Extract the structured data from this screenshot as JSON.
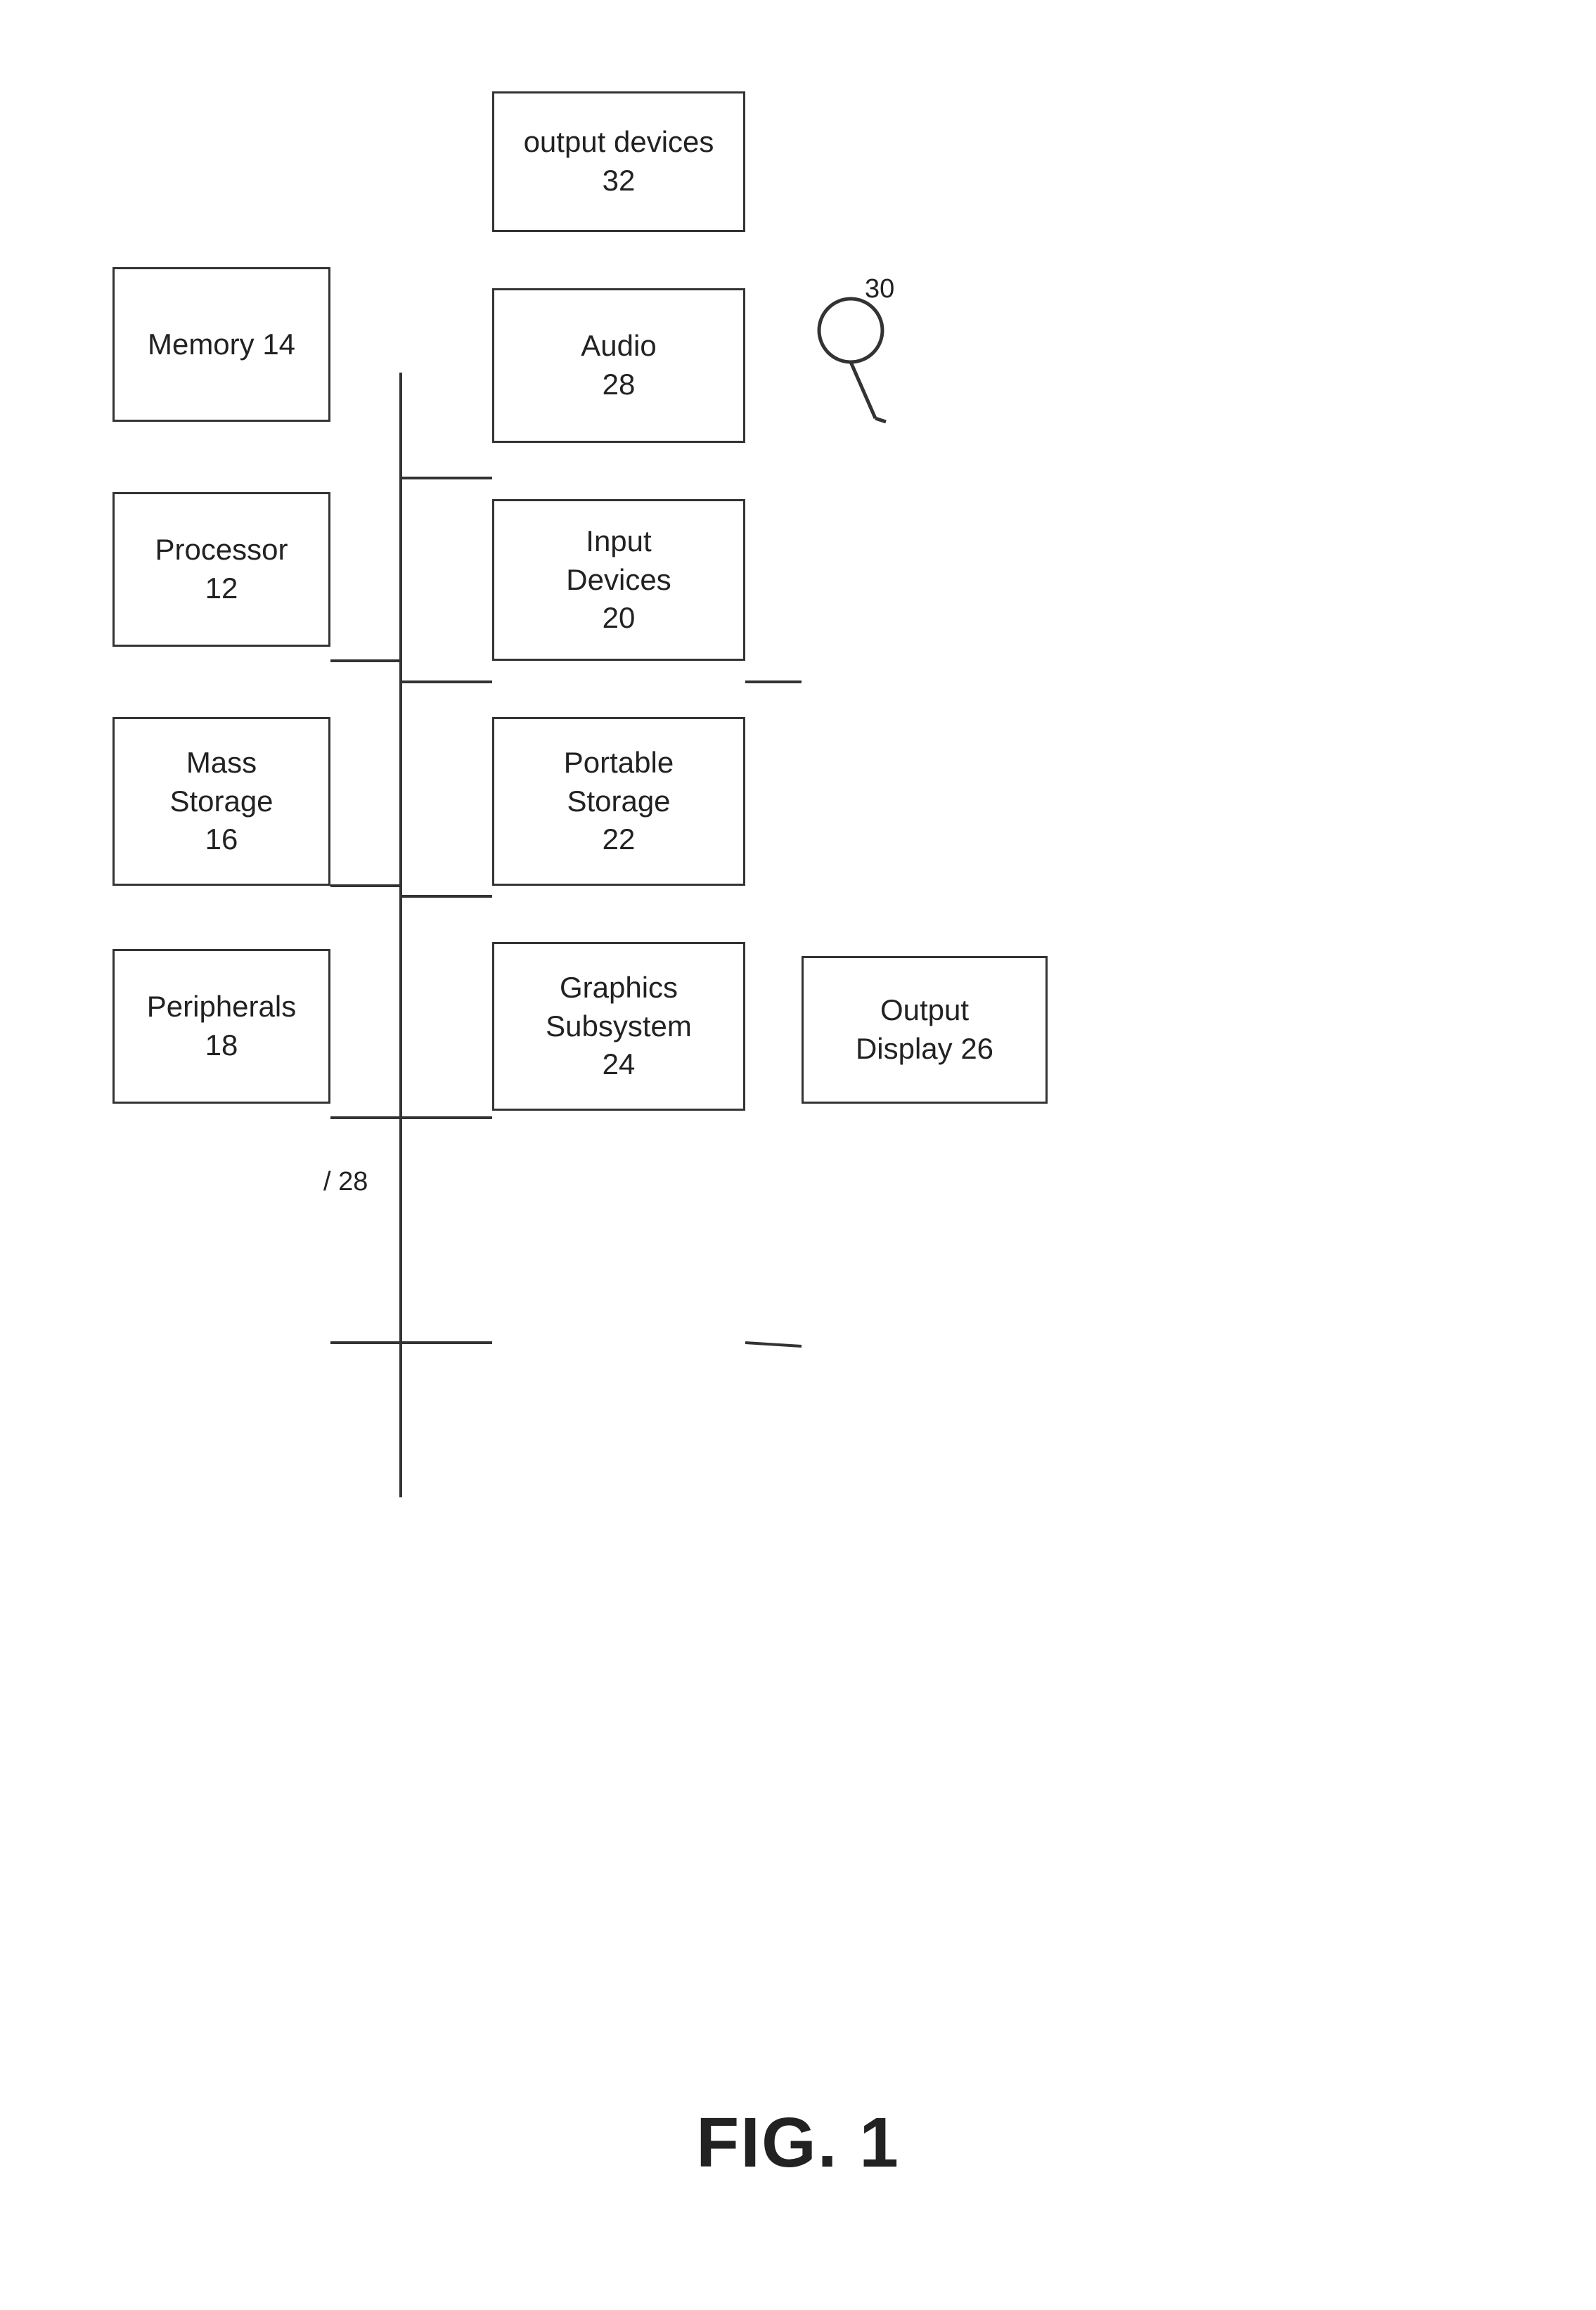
{
  "diagram": {
    "title": "FIG. 1",
    "boxes": {
      "memory": {
        "label": "Memory\n14",
        "id": "14"
      },
      "processor": {
        "label": "Processor\n12",
        "id": "12"
      },
      "mass_storage": {
        "label": "Mass\nStorage\n16",
        "id": "16"
      },
      "peripherals": {
        "label": "Peripherals\n18",
        "id": "18"
      },
      "output_devices": {
        "label": "output devices\n32",
        "id": "32"
      },
      "audio": {
        "label": "Audio\n28",
        "id": "28"
      },
      "input_devices": {
        "label": "Input\nDevices\n20",
        "id": "20"
      },
      "portable_storage": {
        "label": "Portable\nStorage\n22",
        "id": "22"
      },
      "graphics_subsystem": {
        "label": "Graphics\nSubsystem\n24",
        "id": "24"
      },
      "output_display": {
        "label": "Output\nDisplay 26",
        "id": "26"
      }
    },
    "labels": {
      "bus_label": "28",
      "mic_label": "30"
    }
  }
}
